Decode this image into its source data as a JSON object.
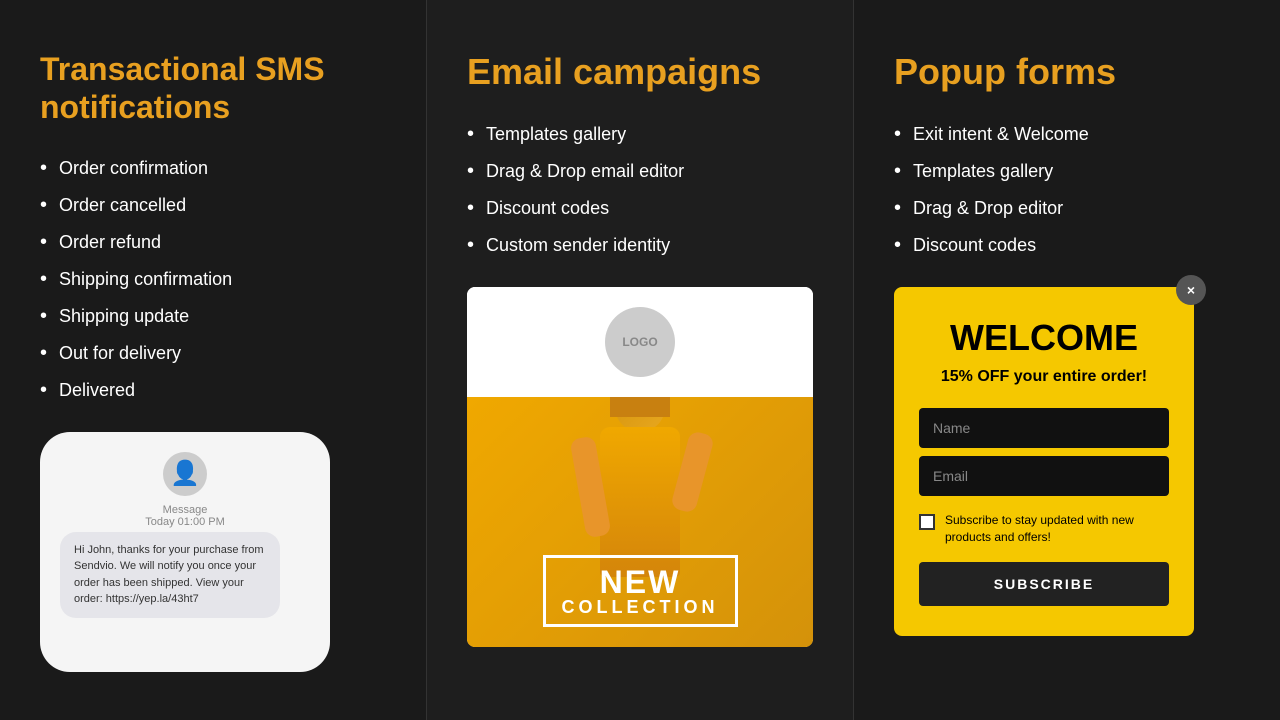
{
  "left_panel": {
    "title": "Transactional SMS notifications",
    "bullets": [
      "Order confirmation",
      "Order cancelled",
      "Order refund",
      "Shipping confirmation",
      "Shipping update",
      "Out for delivery",
      "Delivered"
    ],
    "phone": {
      "avatar_icon": "👤",
      "message_label": "Message",
      "message_time": "Today 01:00 PM",
      "bubble_text": "Hi John, thanks for your purchase from Sendvio. We will notify you once your order has been shipped. View your order: https://yep.la/43ht7"
    }
  },
  "center_panel": {
    "title": "Email campaigns",
    "bullets": [
      "Templates gallery",
      "Drag & Drop email editor",
      "Discount codes",
      "Custom sender identity"
    ],
    "email_preview": {
      "logo_text": "LOGO",
      "badge_line1": "NEW",
      "badge_line2": "COLLECTION"
    }
  },
  "right_panel": {
    "title": "Popup forms",
    "bullets": [
      "Exit intent & Welcome",
      "Templates gallery",
      "Drag & Drop editor",
      "Discount codes"
    ],
    "popup": {
      "close_label": "×",
      "welcome_text": "WELCOME",
      "subtitle": "15% OFF your entire order!",
      "name_placeholder": "Name",
      "email_placeholder": "Email",
      "checkbox_label": "Subscribe to stay updated with new products and offers!",
      "subscribe_button": "SUBSCRIBE"
    }
  }
}
